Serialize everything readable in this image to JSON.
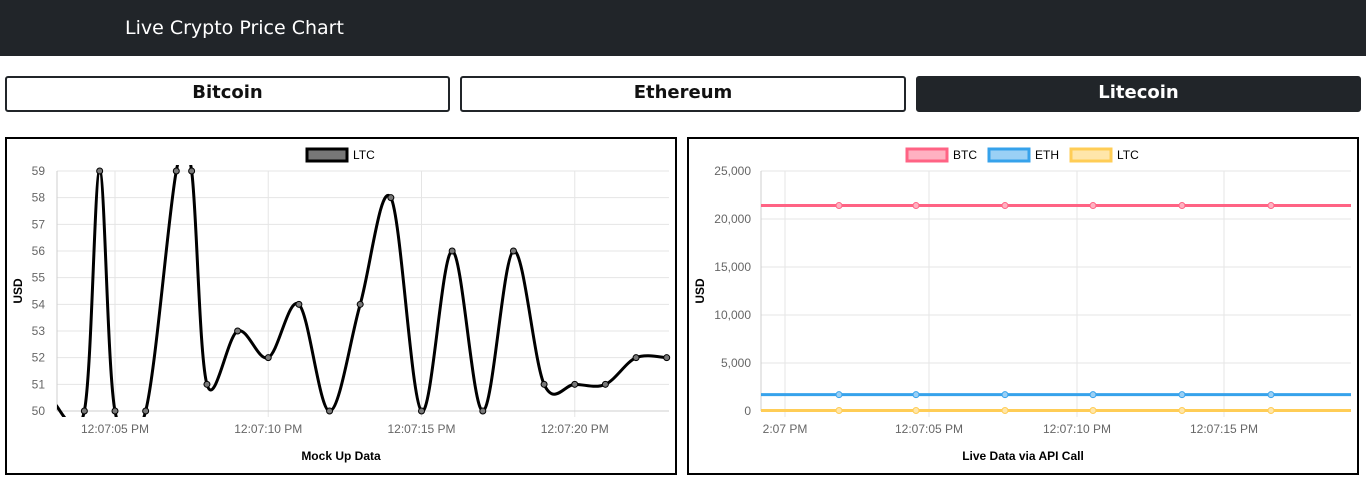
{
  "navbar": {
    "title": "Live Crypto Price Chart"
  },
  "buttons": [
    {
      "label": "Bitcoin",
      "active": false
    },
    {
      "label": "Ethereum",
      "active": false
    },
    {
      "label": "Litecoin",
      "active": true
    }
  ],
  "chart_data": [
    {
      "type": "line",
      "legend": [
        "LTC"
      ],
      "xlabel": "Mock Up Data",
      "ylabel": "USD",
      "ylim": [
        50,
        59
      ],
      "yticks": [
        "59",
        "58",
        "57",
        "56",
        "55",
        "54",
        "53",
        "52",
        "51",
        "50"
      ],
      "xticks": [
        "12:07:05 PM",
        "12:07:10 PM",
        "12:07:15 PM",
        "12:07:20 PM"
      ],
      "series": [
        {
          "name": "LTC",
          "color": "#000000",
          "fill": "#777777",
          "x": [
            "12:07:03",
            "12:07:04",
            "12:07:04.5",
            "12:07:05",
            "12:07:06",
            "12:07:07",
            "12:07:07.5",
            "12:07:08",
            "12:07:09",
            "12:07:10",
            "12:07:11",
            "12:07:12",
            "12:07:13",
            "12:07:14",
            "12:07:15",
            "12:07:16",
            "12:07:17",
            "12:07:18",
            "12:07:19",
            "12:07:20",
            "12:07:21",
            "12:07:22",
            "12:07:23"
          ],
          "values": [
            50.3,
            50,
            59,
            50,
            50,
            59,
            59,
            51,
            53,
            52,
            54,
            50,
            54,
            58,
            50,
            56,
            50,
            56,
            51,
            51,
            51,
            52,
            52
          ]
        }
      ]
    },
    {
      "type": "line",
      "legend": [
        "BTC",
        "ETH",
        "LTC"
      ],
      "xlabel": "Live Data via API Call",
      "ylabel": "USD",
      "ylim": [
        0,
        25000
      ],
      "yticks": [
        "25,000",
        "20,000",
        "15,000",
        "10,000",
        "5,000",
        "0"
      ],
      "xticks": [
        "2:07 PM",
        "12:07:05 PM",
        "12:07:10 PM",
        "12:07:15 PM"
      ],
      "series": [
        {
          "name": "BTC",
          "color": "#ff6384",
          "fill": "#ffb1c1",
          "values": [
            21400,
            21400,
            21400,
            21400,
            21400,
            21400
          ]
        },
        {
          "name": "ETH",
          "color": "#36a2eb",
          "fill": "#9ad0f5",
          "values": [
            1700,
            1700,
            1700,
            1700,
            1700,
            1700
          ]
        },
        {
          "name": "LTC",
          "color": "#ffcd56",
          "fill": "#ffe6aa",
          "values": [
            52,
            52,
            52,
            52,
            52,
            52
          ]
        }
      ]
    }
  ]
}
